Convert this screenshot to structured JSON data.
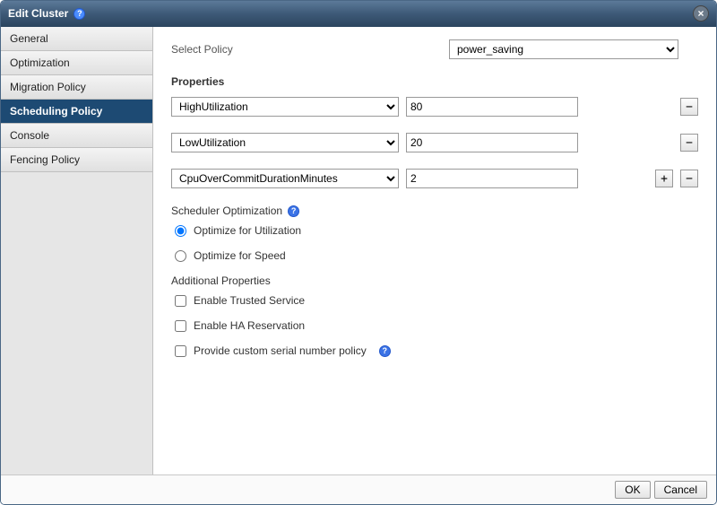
{
  "dialog_title": "Edit Cluster",
  "sidebar": {
    "items": [
      {
        "label": "General",
        "name": "general"
      },
      {
        "label": "Optimization",
        "name": "optimization"
      },
      {
        "label": "Migration Policy",
        "name": "migration-policy"
      },
      {
        "label": "Scheduling Policy",
        "name": "scheduling-policy"
      },
      {
        "label": "Console",
        "name": "console"
      },
      {
        "label": "Fencing Policy",
        "name": "fencing-policy"
      }
    ],
    "selected_index": 3
  },
  "select_policy": {
    "label": "Select Policy",
    "value": "power_saving"
  },
  "properties": {
    "heading": "Properties",
    "rows": [
      {
        "name": "HighUtilization",
        "value": "80",
        "show_add": false
      },
      {
        "name": "LowUtilization",
        "value": "20",
        "show_add": false
      },
      {
        "name": "CpuOverCommitDurationMinutes",
        "value": "2",
        "show_add": true
      }
    ],
    "add_symbol": "+",
    "remove_symbol": "−"
  },
  "scheduler_opt": {
    "heading": "Scheduler Optimization",
    "options": [
      {
        "label": "Optimize for Utilization"
      },
      {
        "label": "Optimize for Speed"
      }
    ],
    "selected_index": 0
  },
  "additional_props": {
    "heading": "Additional Properties",
    "items": [
      {
        "label": "Enable Trusted Service",
        "checked": false,
        "help": false
      },
      {
        "label": "Enable HA Reservation",
        "checked": false,
        "help": false
      },
      {
        "label": "Provide custom serial number policy",
        "checked": false,
        "help": true
      }
    ]
  },
  "footer": {
    "ok": "OK",
    "cancel": "Cancel"
  }
}
